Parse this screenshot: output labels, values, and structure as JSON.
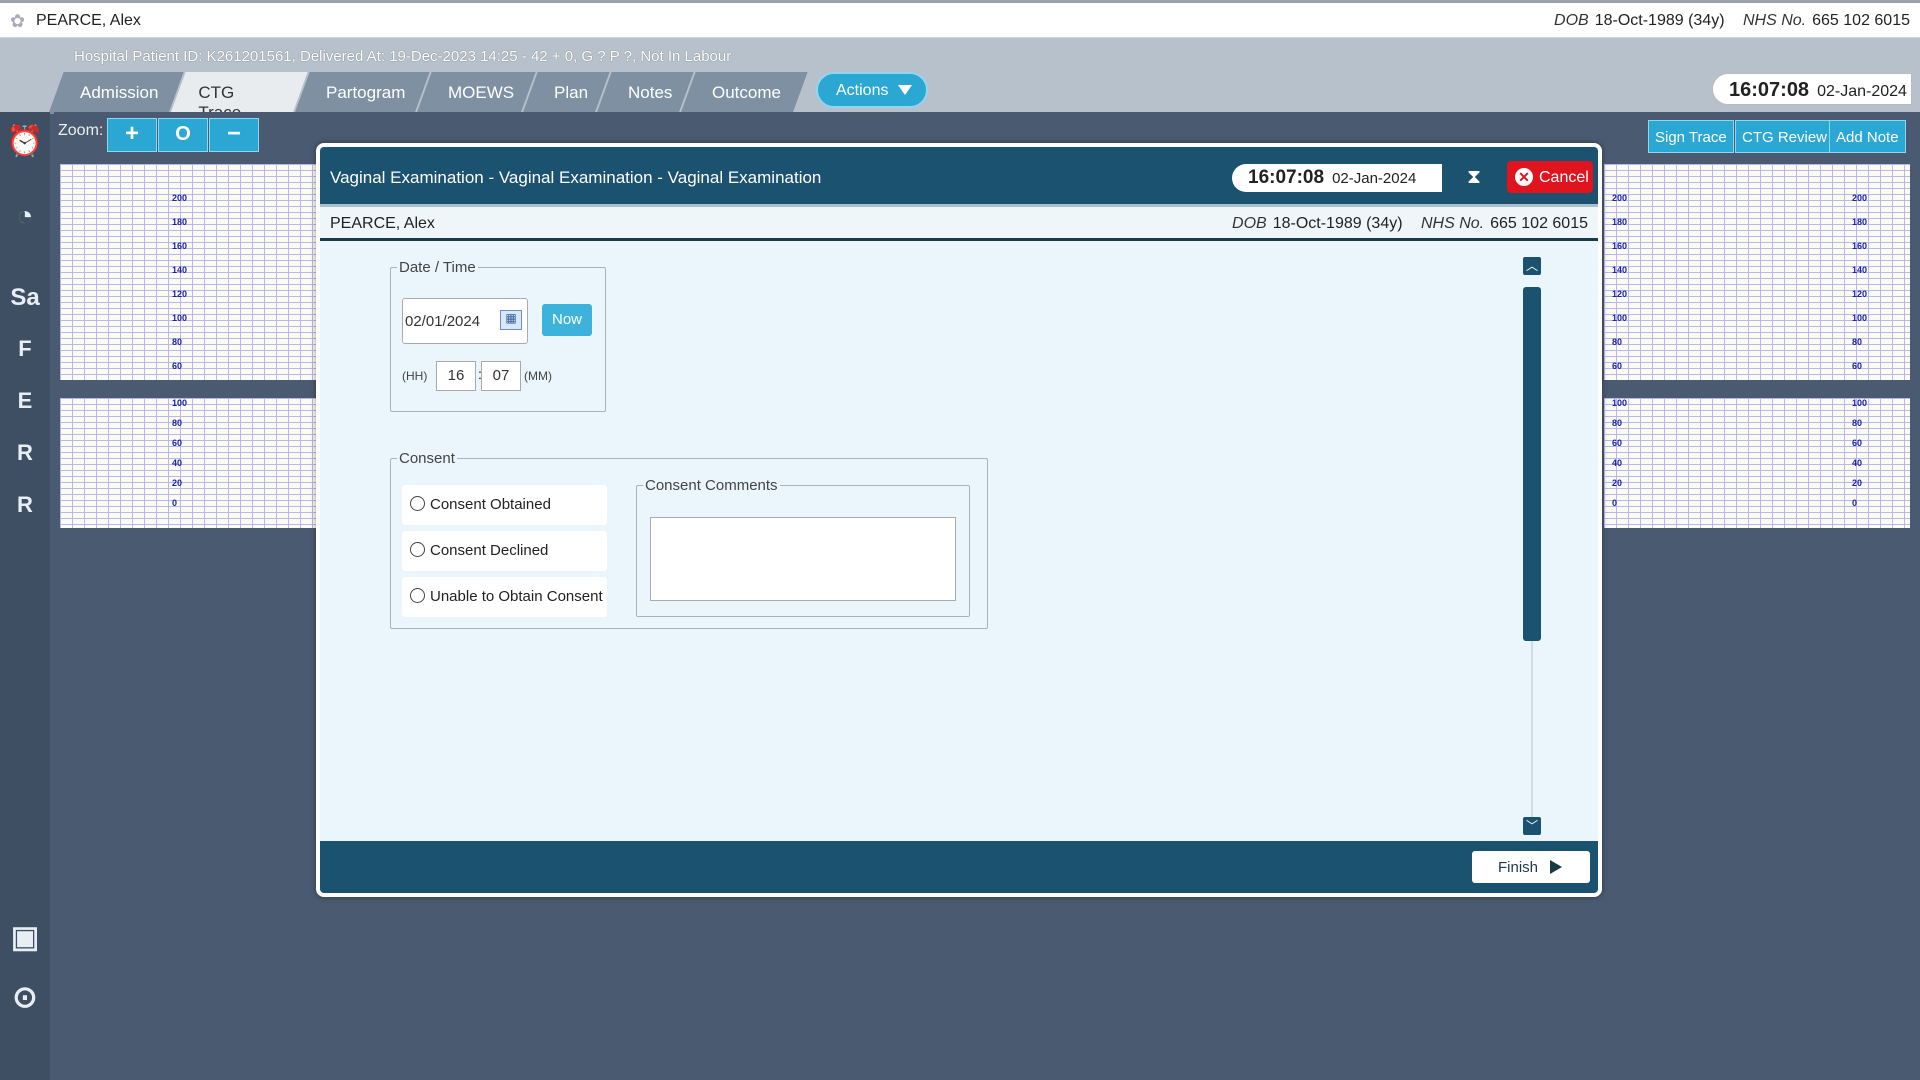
{
  "topbar": {
    "patient_name": "PEARCE, Alex",
    "dob_label": "DOB",
    "dob": "18-Oct-1989 (34y)",
    "nhs_label": "NHS No.",
    "nhs": "665 102 6015"
  },
  "band": {
    "patient_info": "Hospital Patient ID: K261201561, Delivered At: 19-Dec-2023 14:25 - 42 + 0, G ? P ?,   Not In Labour"
  },
  "tabs": [
    {
      "label": "Admission"
    },
    {
      "label": "CTG Trace"
    },
    {
      "label": "Partogram"
    },
    {
      "label": "MOEWS"
    },
    {
      "label": "Plan"
    },
    {
      "label": "Notes"
    },
    {
      "label": "Outcome"
    }
  ],
  "actions_label": "Actions",
  "clock": {
    "time": "16:07:08",
    "date": "02-Jan-2024"
  },
  "sidebar": {
    "letters": [
      "Sa",
      "F",
      "E",
      "R",
      "R"
    ]
  },
  "zoom": {
    "label": "Zoom:",
    "plus": "+",
    "reset": "O",
    "minus": "−"
  },
  "right_buttons": [
    "Sign Trace",
    "CTG Review",
    "Add Note"
  ],
  "trace_axis": {
    "fhr": [
      "200",
      "180",
      "160",
      "140",
      "120",
      "100",
      "80",
      "60"
    ],
    "toco": [
      "100",
      "80",
      "60",
      "40",
      "20",
      "0"
    ]
  },
  "modal": {
    "title": "Vaginal Examination - Vaginal Examination - Vaginal Examination",
    "clock_time": "16:07:08",
    "clock_date": "02-Jan-2024",
    "cancel_label": "Cancel",
    "patient_name": "PEARCE, Alex",
    "dob_label": "DOB",
    "dob": "18-Oct-1989 (34y)",
    "nhs_label": "NHS No.",
    "nhs": "665 102 6015",
    "datetime": {
      "legend": "Date / Time",
      "date_value": "02/01/2024",
      "now_label": "Now",
      "hh_label": "(HH)",
      "hh": "16",
      "mm": "07",
      "mm_label": "(MM)"
    },
    "consent": {
      "legend": "Consent",
      "options": [
        "Consent Obtained",
        "Consent Declined",
        "Unable to Obtain Consent"
      ],
      "comments_legend": "Consent Comments"
    },
    "finish_label": "Finish"
  }
}
